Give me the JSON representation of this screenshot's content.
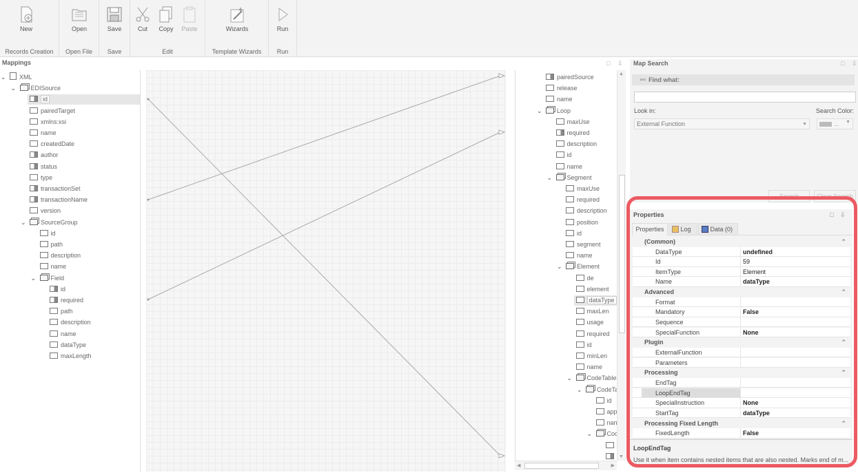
{
  "ribbon": {
    "groups": [
      {
        "label": "Records Creation",
        "buttons": [
          {
            "label": "New",
            "icon": "new-icon"
          }
        ]
      },
      {
        "label": "Open File",
        "buttons": [
          {
            "label": "Open",
            "icon": "open-icon"
          }
        ]
      },
      {
        "label": "Save",
        "buttons": [
          {
            "label": "Save",
            "icon": "save-icon"
          }
        ]
      },
      {
        "label": "Edit",
        "buttons": [
          {
            "label": "Cut",
            "icon": "cut-icon"
          },
          {
            "label": "Copy",
            "icon": "copy-icon"
          },
          {
            "label": "Paste",
            "icon": "paste-icon",
            "disabled": true
          }
        ]
      },
      {
        "label": "Template Wizards",
        "buttons": [
          {
            "label": "Wizards",
            "icon": "wizard-icon"
          }
        ]
      },
      {
        "label": "Run",
        "buttons": [
          {
            "label": "Run",
            "icon": "run-icon"
          }
        ]
      }
    ]
  },
  "mappings": {
    "title": "Mappings",
    "source_tree": [
      {
        "label": "XML",
        "icon": "doc",
        "level": 0,
        "chevron": true
      },
      {
        "label": "EDISource",
        "icon": "grp",
        "level": 1,
        "chevron": true
      },
      {
        "label": "id",
        "icon": "fill",
        "level": 2,
        "selected": true
      },
      {
        "label": "pairedTarget",
        "icon": "box",
        "level": 2
      },
      {
        "label": "xmlns:xsi",
        "icon": "box",
        "level": 2
      },
      {
        "label": "name",
        "icon": "box",
        "level": 2
      },
      {
        "label": "createdDate",
        "icon": "box",
        "level": 2
      },
      {
        "label": "author",
        "icon": "fill",
        "level": 2
      },
      {
        "label": "status",
        "icon": "fill",
        "level": 2
      },
      {
        "label": "type",
        "icon": "box",
        "level": 2
      },
      {
        "label": "transactionSet",
        "icon": "fill",
        "level": 2
      },
      {
        "label": "transactionName",
        "icon": "fill",
        "level": 2
      },
      {
        "label": "version",
        "icon": "box",
        "level": 2
      },
      {
        "label": "SourceGroup",
        "icon": "grp",
        "level": 2,
        "chevron": true
      },
      {
        "label": "id",
        "icon": "box",
        "level": 3
      },
      {
        "label": "path",
        "icon": "box",
        "level": 3
      },
      {
        "label": "description",
        "icon": "box",
        "level": 3
      },
      {
        "label": "name",
        "icon": "box",
        "level": 3
      },
      {
        "label": "Field",
        "icon": "grp",
        "level": 3,
        "chevron": true
      },
      {
        "label": "id",
        "icon": "fill",
        "level": 4
      },
      {
        "label": "required",
        "icon": "fill",
        "level": 4
      },
      {
        "label": "path",
        "icon": "box",
        "level": 4
      },
      {
        "label": "description",
        "icon": "box",
        "level": 4
      },
      {
        "label": "name",
        "icon": "box",
        "level": 4
      },
      {
        "label": "dataType",
        "icon": "box",
        "level": 4
      },
      {
        "label": "maxLength",
        "icon": "box",
        "level": 4
      }
    ],
    "target_tree": [
      {
        "label": "pairedSource",
        "icon": "fill",
        "level": 0
      },
      {
        "label": "release",
        "icon": "box",
        "level": 0
      },
      {
        "label": "name",
        "icon": "box",
        "level": 0
      },
      {
        "label": "Loop",
        "icon": "grp",
        "level": 0,
        "chevron": true
      },
      {
        "label": "maxUse",
        "icon": "box",
        "level": 1
      },
      {
        "label": "required",
        "icon": "fill",
        "level": 1
      },
      {
        "label": "description",
        "icon": "box",
        "level": 1
      },
      {
        "label": "id",
        "icon": "box",
        "level": 1
      },
      {
        "label": "name",
        "icon": "box",
        "level": 1
      },
      {
        "label": "Segment",
        "icon": "grp",
        "level": 1,
        "chevron": true
      },
      {
        "label": "maxUse",
        "icon": "box",
        "level": 2
      },
      {
        "label": "required",
        "icon": "box",
        "level": 2
      },
      {
        "label": "description",
        "icon": "box",
        "level": 2
      },
      {
        "label": "position",
        "icon": "box",
        "level": 2
      },
      {
        "label": "id",
        "icon": "box",
        "level": 2
      },
      {
        "label": "segment",
        "icon": "box",
        "level": 2
      },
      {
        "label": "name",
        "icon": "box",
        "level": 2
      },
      {
        "label": "Element",
        "icon": "grp",
        "level": 2,
        "chevron": true
      },
      {
        "label": "de",
        "icon": "box",
        "level": 3
      },
      {
        "label": "element",
        "icon": "box",
        "level": 3
      },
      {
        "label": "dataType",
        "icon": "box",
        "level": 3,
        "selected": true
      },
      {
        "label": "maxLen",
        "icon": "box",
        "level": 3
      },
      {
        "label": "usage",
        "icon": "box",
        "level": 3
      },
      {
        "label": "required",
        "icon": "box",
        "level": 3
      },
      {
        "label": "id",
        "icon": "box",
        "level": 3
      },
      {
        "label": "minLen",
        "icon": "box",
        "level": 3
      },
      {
        "label": "name",
        "icon": "box",
        "level": 3
      },
      {
        "label": "CodeTables",
        "icon": "grp",
        "level": 3,
        "chevron": true
      },
      {
        "label": "CodeTa",
        "icon": "grp",
        "level": 4,
        "chevron": true
      },
      {
        "label": "id",
        "icon": "box",
        "level": 5
      },
      {
        "label": "app",
        "icon": "box",
        "level": 5
      },
      {
        "label": "nan",
        "icon": "box",
        "level": 5
      },
      {
        "label": "Coc",
        "icon": "grp",
        "level": 5,
        "chevron": true
      },
      {
        "label": "",
        "icon": "box",
        "level": 6
      },
      {
        "label": "",
        "icon": "fill",
        "level": 6
      }
    ]
  },
  "map_search": {
    "title": "Map Search",
    "find_label": "Find what:",
    "find_value": "",
    "look_in_label": "Look in:",
    "look_in_value": "External Function",
    "search_color_label": "Search Color:",
    "search_color_value": "...",
    "search_button": "Search",
    "clear_button": "Clear Search"
  },
  "properties": {
    "title": "Properties",
    "tabs": [
      {
        "label": "Properties",
        "icon": ""
      },
      {
        "label": "Log",
        "icon": "log-icon"
      },
      {
        "label": "Data (0)",
        "icon": "data-icon"
      }
    ],
    "categories": [
      {
        "name": "(Common)",
        "rows": [
          {
            "key": "DataType",
            "value": "undefined",
            "bold": true
          },
          {
            "key": "Id",
            "value": "59",
            "bold": false
          },
          {
            "key": "ItemType",
            "value": "Element",
            "bold": false
          },
          {
            "key": "Name",
            "value": "dataType",
            "bold": true
          }
        ]
      },
      {
        "name": "Advanced",
        "rows": [
          {
            "key": "Format",
            "value": "",
            "bold": false
          },
          {
            "key": "Mandatory",
            "value": "False",
            "bold": true
          },
          {
            "key": "Sequence",
            "value": "",
            "bold": false
          },
          {
            "key": "SpecialFunction",
            "value": "None",
            "bold": true
          }
        ]
      },
      {
        "name": "Plugin",
        "rows": [
          {
            "key": "ExternalFunction",
            "value": "",
            "bold": false
          },
          {
            "key": "Parameters",
            "value": "",
            "bold": false
          }
        ]
      },
      {
        "name": "Processing",
        "rows": [
          {
            "key": "EndTag",
            "value": "",
            "bold": false
          },
          {
            "key": "LoopEndTag",
            "value": "",
            "bold": false,
            "selected": true
          },
          {
            "key": "SpecialInstruction",
            "value": "None",
            "bold": true
          },
          {
            "key": "StartTag",
            "value": "dataType",
            "bold": true
          }
        ]
      },
      {
        "name": "Processing Fixed Length",
        "rows": [
          {
            "key": "FixedLength",
            "value": "False",
            "bold": true
          }
        ]
      }
    ],
    "description_title": "LoopEndTag",
    "description_text": "Use it when item contains nested items that are also nested. Marks end of m..."
  },
  "colors": {
    "highlight": "#ec5a62",
    "selected_row": "#e6e6e6",
    "grid": "#ececec"
  }
}
